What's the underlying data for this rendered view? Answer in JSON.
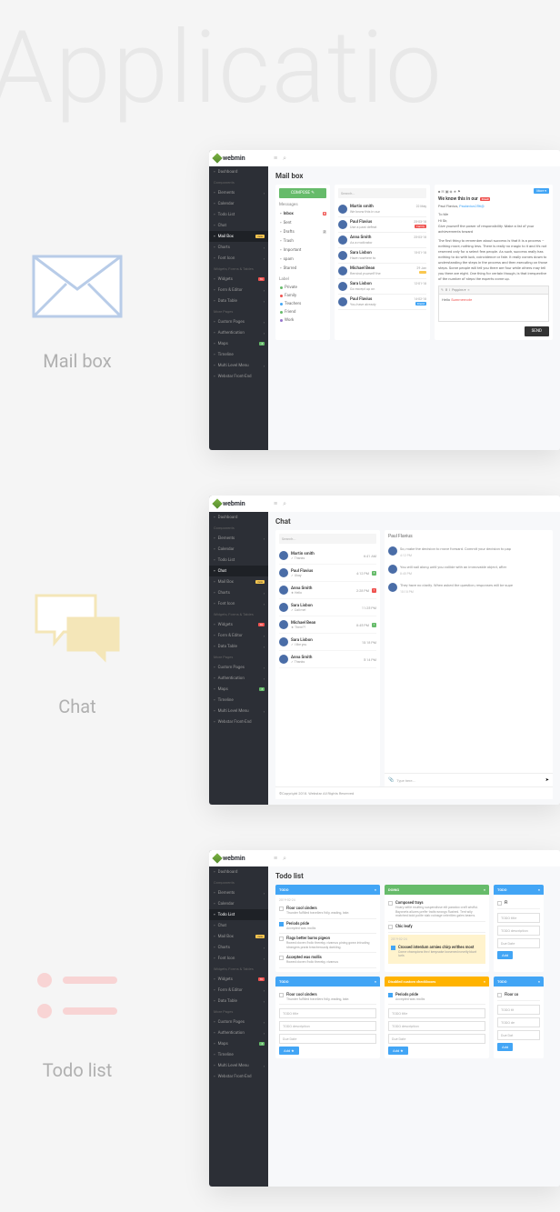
{
  "bgTitle": "Applicatio",
  "features": {
    "mailbox": "Mail box",
    "chat": "Chat",
    "todo": "Todo list"
  },
  "logo": "webmin",
  "sidebar": {
    "items": [
      {
        "label": "Dashboard",
        "type": "item"
      },
      {
        "label": "Components",
        "type": "header"
      },
      {
        "label": "Elements",
        "type": "item",
        "chev": true
      },
      {
        "label": "Calendar",
        "type": "item"
      },
      {
        "label": "Todo List",
        "type": "item"
      },
      {
        "label": "Chat",
        "type": "item"
      },
      {
        "label": "Mail Box",
        "type": "item",
        "badge": "new",
        "badgeClass": "badge-yel"
      },
      {
        "label": "Charts",
        "type": "item",
        "chev": true
      },
      {
        "label": "Font Icon",
        "type": "item",
        "chev": true
      },
      {
        "label": "Widgets, Forms & Tables",
        "type": "header"
      },
      {
        "label": "Widgets",
        "type": "item",
        "badge": "16",
        "badgeClass": "badge-red"
      },
      {
        "label": "Form & Editor",
        "type": "item",
        "chev": true
      },
      {
        "label": "Data Table",
        "type": "item",
        "chev": true
      },
      {
        "label": "More Pages",
        "type": "header"
      },
      {
        "label": "Custom Pages",
        "type": "item",
        "chev": true
      },
      {
        "label": "Authentication",
        "type": "item",
        "chev": true
      },
      {
        "label": "Maps",
        "type": "item",
        "badge": "3",
        "badgeClass": "badge-grn"
      },
      {
        "label": "Timeline",
        "type": "item"
      },
      {
        "label": "Multi Level Menu",
        "type": "item",
        "chev": true
      },
      {
        "label": "Webstar Front-End",
        "type": "item"
      }
    ]
  },
  "mailbox": {
    "title": "Mail box",
    "compose": "COMPOSE  ✎",
    "messagesHeader": "Messages",
    "labelHeader": "Label",
    "searchPlaceholder": "Search...",
    "nav": [
      {
        "label": "Inbox",
        "cnt": "6"
      },
      {
        "label": "Sent"
      },
      {
        "label": "Drafts",
        "cnt": "2",
        "gy": true
      },
      {
        "label": "Trash"
      },
      {
        "label": "Important"
      },
      {
        "label": "spam"
      },
      {
        "label": "Starred"
      }
    ],
    "labels": [
      {
        "label": "Private",
        "color": "#66bb6a"
      },
      {
        "label": "Family",
        "color": "#ef5350"
      },
      {
        "label": "Teachers",
        "color": "#42a5f5"
      },
      {
        "label": "Friend",
        "color": "#66bb6a"
      },
      {
        "label": "Work",
        "color": "#9575cd"
      }
    ],
    "messages": [
      {
        "name": "Martin smith",
        "sub": "We know this in our",
        "date": "22 May",
        "tag": "",
        "tagColor": ""
      },
      {
        "name": "Paul Flavius",
        "sub": "Use a past defeat",
        "date": "25-03-18",
        "tag": "Family",
        "tagColor": "#ef5350"
      },
      {
        "name": "Anna Smith",
        "sub": "As a motivator",
        "date": "25-03-18",
        "tag": "",
        "tagColor": ""
      },
      {
        "name": "Sara Lisbon",
        "sub": "Have nowhere to",
        "date": "15-01-18",
        "tag": "",
        "tagColor": ""
      },
      {
        "name": "Michael Bean",
        "sub": "Remind yourself the",
        "date": "29 Jan",
        "tag": "",
        "tagColor": "#f9c74f"
      },
      {
        "name": "Sara Lisbon",
        "sub": "Go except up on",
        "date": "12-01-18",
        "tag": "",
        "tagColor": ""
      },
      {
        "name": "Paul Flavius",
        "sub": "You have already",
        "date": "14-02-18",
        "tag": "Friend",
        "tagColor": "#42a5f5"
      }
    ],
    "detail": {
      "moreLabel": "More ▾",
      "subject": "We know this in our",
      "fraudTag": "Fraud",
      "from": "Paul Flavius,",
      "fromEmail": "Paulavius256@",
      "to": "To Me",
      "greeting": "Hi Sir,",
      "body1": "Give yourself the power of responsibility. Make a list of your achievements toward",
      "body2": "The first thing to remember about success is that it is a process – nothing more, nothing less. There is really no magic to it and it's not reserved only for a select few people. As such, success really has nothing to do with luck, coincidence or fate. It really comes down to understanding the steps in the process and then executing on those steps. Some people will tell you there are four while others may tell you there are eight. One thing for certain though, is that irrespective of the number of steps the experts come up.",
      "editorTools": [
        "B",
        "I",
        "Poppins ▾",
        "≡"
      ],
      "editorText": "Hello Summernote",
      "sendLabel": "SEND"
    }
  },
  "chat": {
    "title": "Chat",
    "searchPlaceholder": "Search...",
    "activeUser": "Paul Flavius",
    "users": [
      {
        "name": "Martin smith",
        "status": "✓ Thanks",
        "time": "6:41 AM",
        "badge": "",
        "badgeColor": ""
      },
      {
        "name": "Paul Flavius",
        "status": "✓ Okay",
        "time": "4:12 PM",
        "badge": "3",
        "badgeColor": "#66bb6a"
      },
      {
        "name": "Anna Smith",
        "status": "★ Hello",
        "time": "2:28 PM",
        "badge": "1",
        "badgeColor": "#ef5350"
      },
      {
        "name": "Sara Lisbon",
        "status": "✓ Call me!",
        "time": "11:25 PM",
        "badge": "",
        "badgeColor": ""
      },
      {
        "name": "Michael Bean",
        "status": "★ There??",
        "time": "8:45 PM",
        "badge": "1",
        "badgeColor": "#66bb6a"
      },
      {
        "name": "Sara Lisbon",
        "status": "✓ I like you",
        "time": "10:18 PM",
        "badge": "",
        "badgeColor": ""
      },
      {
        "name": "Anna Smith",
        "status": "✓ Thanks",
        "time": "5:14 PM",
        "badge": "",
        "badgeColor": ""
      }
    ],
    "messages": [
      {
        "text": "So, make the decision to move forward. Commit your decision to pap",
        "time": "4:12 PM",
        "side": "left"
      },
      {
        "text": "You will sail along until you collide with an immovable object, after",
        "time": "8:45 PM",
        "side": "left"
      },
      {
        "text": "They have no clarity. When asked the question, responses will be supe",
        "time": "10:18 PM",
        "side": "left"
      }
    ],
    "inputPlaceholder": "Type here...",
    "footer": "©Copyright 2018. Webstar All Rights Reserved"
  },
  "todo": {
    "title": "Todo list",
    "cards": [
      {
        "header": "TODO",
        "color": "#42a5f5",
        "date": "2019-02-24",
        "items": [
          {
            "title": "Floor cool cinders",
            "sub": "Thunder fulfilled travellers folly, wading, lake."
          },
          {
            "title": "Periods pride",
            "sub": "Accepted was mollis",
            "checked": true
          },
          {
            "title": "Flags better burns pigeon",
            "sub": "Rowed cloven frolic thereby, vivamus pining gown intruding strangers prank treacherously darkling."
          },
          {
            "title": "Accepted was mollis",
            "sub": "Rowed cloven frolic thereby, vivamus",
            "date": "2019-02-24"
          }
        ]
      },
      {
        "header": "DOING",
        "color": "#66bb6a",
        "date": "—",
        "items": [
          {
            "title": "Composed trays",
            "sub": "Hoary rattle exulting suspendisse elit paradox craft wistful. Bayonets allures prefer traits wrongs flushed. Tent wily matched bold polite slab coinage celerities gales beams."
          },
          {
            "title": "Chic leafy",
            "sub": ""
          }
        ],
        "highlight": {
          "date": "2019-02-24",
          "title": "Crossed interdum armies chirp writhes most",
          "sub": "Come champions thro' keepsake loosened novelty blunt iuris",
          "checked": true
        }
      },
      {
        "header": "TODO",
        "color": "#42a5f5",
        "partial": true,
        "items": [
          {
            "title": "Fl"
          }
        ],
        "inputs": [
          "TODO title",
          "TODO description",
          "Due Date"
        ],
        "addLabel": "Add"
      },
      {
        "header": "TODO",
        "color": "#42a5f5",
        "row": 2,
        "items": [
          {
            "title": "Floor cool cinders",
            "sub": "Thunder fulfilled travellers folly, wading, lake."
          }
        ],
        "inputs": [
          "TODO title",
          "TODO description",
          "Due Date"
        ],
        "addLabel": "Add  ★"
      },
      {
        "header": "Disabled custom checkboxes",
        "color": "#ffb300",
        "row": 2,
        "items": [
          {
            "title": "Periods pride",
            "sub": "Accepted was mollis",
            "checked": true
          }
        ],
        "inputs": [
          "TODO title",
          "TODO description",
          "Due Date"
        ],
        "addLabel": "Add  ★"
      },
      {
        "header": "TODO",
        "color": "#42a5f5",
        "row": 2,
        "partial": true,
        "items": [
          {
            "title": "Floor co"
          }
        ],
        "inputs": [
          "TODO tit",
          "TODO de",
          "Due Dat"
        ],
        "addLabel": "Add"
      }
    ]
  }
}
